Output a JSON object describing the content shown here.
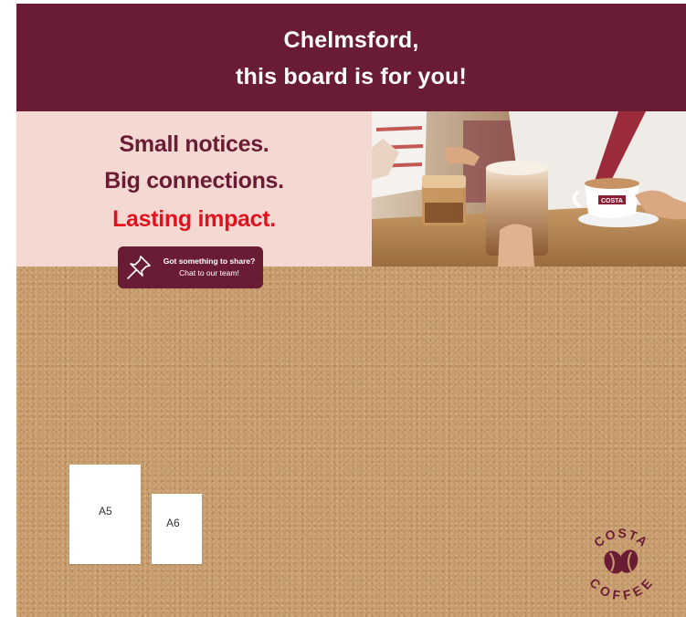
{
  "header": {
    "line1": "Chelmsford,",
    "line2": "this board is for you!"
  },
  "promo": {
    "line1": "Small notices.",
    "line2": "Big connections.",
    "line3": "Lasting impact.",
    "cta_title": "Got something to share?",
    "cta_subtitle": "Chat to our team!"
  },
  "photo": {
    "cup_brand": "COSTA"
  },
  "cork_board": {
    "notes": [
      {
        "label": "A5"
      },
      {
        "label": "A6"
      }
    ]
  },
  "logo": {
    "top_text": "COSTA",
    "bottom_text": "COFFEE"
  },
  "colors": {
    "brand_maroon": "#6b1c35",
    "accent_red": "#e3101e",
    "promo_background": "#f3d9d2",
    "cork": "#c79c6d"
  },
  "icons": [
    "pushpin-icon"
  ]
}
